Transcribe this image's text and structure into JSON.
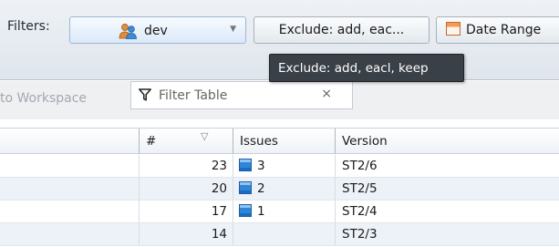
{
  "filters": {
    "label": "Filters:",
    "user_combo": {
      "value": "dev",
      "icon": "users-icon"
    },
    "exclude_button": {
      "label": "Exclude: add, eac..."
    },
    "date_range_button": {
      "label": "Date Range",
      "icon": "calendar-icon"
    },
    "tooltip": "Exclude: add, eacl, keep"
  },
  "toolbar": {
    "workspace_link": "to Workspace",
    "filter_table": {
      "placeholder": "Filter Table",
      "clear_glyph": "×"
    }
  },
  "table": {
    "columns": {
      "num": "#",
      "issues": "Issues",
      "version": "Version"
    },
    "sort_glyph": "▽",
    "rows": [
      {
        "num": "23",
        "issues": "3",
        "version": "ST2/6"
      },
      {
        "num": "20",
        "issues": "2",
        "version": "ST2/5"
      },
      {
        "num": "17",
        "issues": "1",
        "version": "ST2/4"
      },
      {
        "num": "14",
        "issues": "",
        "version": "ST2/3"
      }
    ]
  },
  "colors": {
    "tooltip_bg": "#3a4048",
    "row_alt_bg": "#edf2f8",
    "issue_icon": "#2f86d8",
    "combo_border": "#9fb7d2"
  }
}
